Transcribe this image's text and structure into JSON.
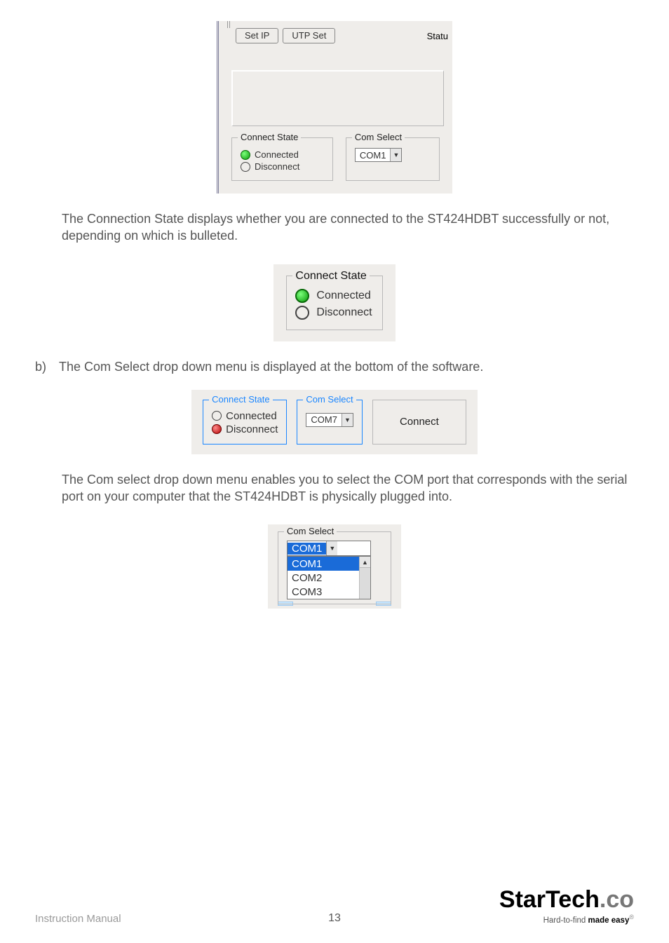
{
  "fig1": {
    "tabs": {
      "setip": "Set IP",
      "utpset": "UTP Set",
      "status_cut": "Statu"
    },
    "connect_state": {
      "legend": "Connect State",
      "connected": "Connected",
      "disconnect": "Disconnect"
    },
    "com_select": {
      "legend": "Com Select",
      "value": "COM1"
    }
  },
  "para1": "The Connection State displays whether you are connected to the ST424HDBT successfully or not, depending on which is bulleted.",
  "fig2": {
    "legend": "Connect State",
    "connected": "Connected",
    "disconnect": "Disconnect"
  },
  "item_b": {
    "marker": "b)",
    "text": "The Com Select drop down menu is displayed at the bottom of the software."
  },
  "fig3": {
    "connect_state": {
      "legend": "Connect State",
      "connected": "Connected",
      "disconnect": "Disconnect"
    },
    "com_select": {
      "legend": "Com Select",
      "value": "COM7"
    },
    "connect_btn": "Connect"
  },
  "para2": "The Com select drop down menu enables you to select the COM port that corresponds with the serial port on your computer that the ST424HDBT is physically plugged into.",
  "fig4": {
    "legend": "Com Select",
    "value": "COM1",
    "options": [
      "COM1",
      "COM2",
      "COM3"
    ]
  },
  "footer": {
    "left": "Instruction Manual",
    "page": "13",
    "brand_a": "Star",
    "brand_b": "Tech",
    "brand_c": ".co",
    "tag_a": "Hard-to-find ",
    "tag_b": "made easy",
    "reg": "®"
  }
}
